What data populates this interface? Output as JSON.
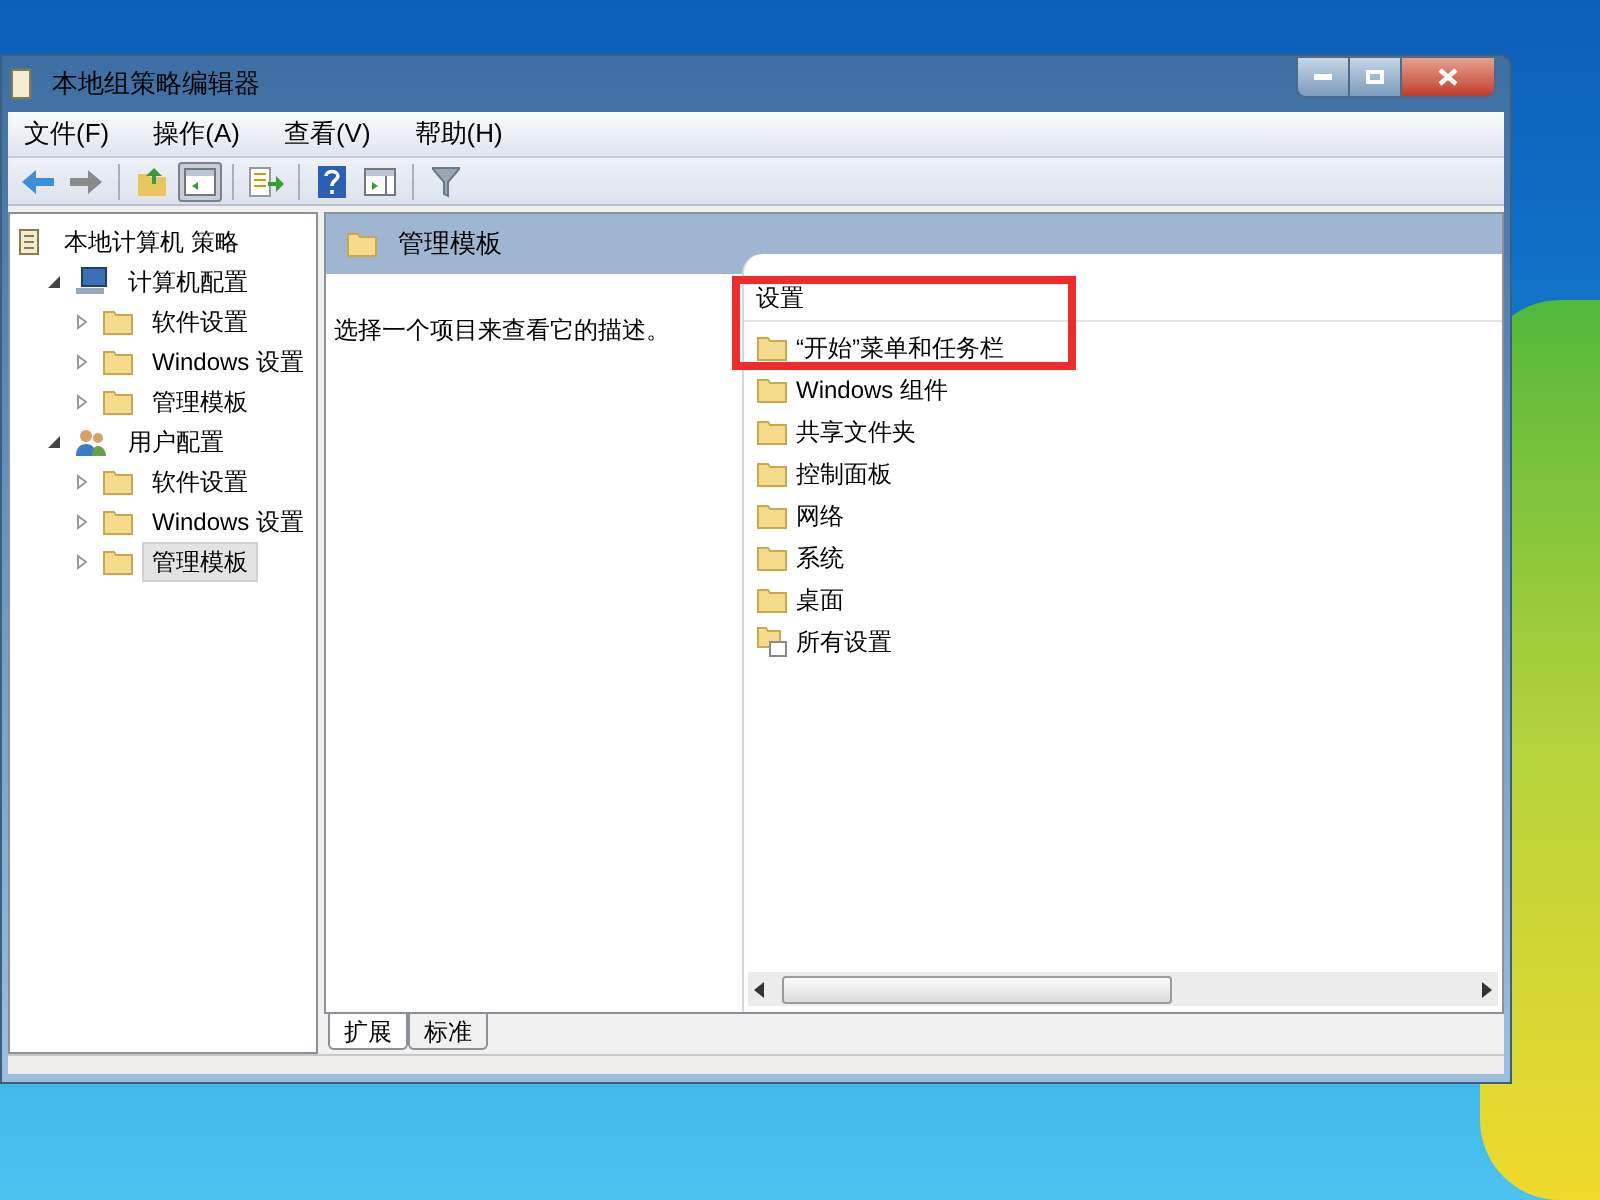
{
  "window": {
    "title": "本地组策略编辑器"
  },
  "menu": [
    "文件(F)",
    "操作(A)",
    "查看(V)",
    "帮助(H)"
  ],
  "toolbar": [
    {
      "kind": "back",
      "pressed": false
    },
    {
      "kind": "forward",
      "pressed": false
    },
    {
      "kind": "up",
      "pressed": false
    },
    {
      "kind": "tree",
      "pressed": true
    },
    {
      "kind": "export",
      "pressed": false
    },
    {
      "kind": "help",
      "pressed": false
    },
    {
      "kind": "pane",
      "pressed": false
    },
    {
      "kind": "filter",
      "pressed": false
    }
  ],
  "tree": [
    {
      "label": "本地计算机 策略",
      "kind": "policy",
      "selected": false,
      "children": [
        {
          "label": "计算机配置",
          "kind": "computer",
          "expanded": true,
          "selected": false,
          "children": [
            {
              "label": "软件设置",
              "kind": "folder",
              "expanded": false,
              "selected": false
            },
            {
              "label": "Windows 设置",
              "kind": "folder",
              "expanded": false,
              "selected": false
            },
            {
              "label": "管理模板",
              "kind": "folder",
              "expanded": false,
              "selected": false
            }
          ]
        },
        {
          "label": "用户配置",
          "kind": "user",
          "expanded": true,
          "selected": false,
          "children": [
            {
              "label": "软件设置",
              "kind": "folder",
              "expanded": false,
              "selected": false
            },
            {
              "label": "Windows 设置",
              "kind": "folder",
              "expanded": false,
              "selected": false
            },
            {
              "label": "管理模板",
              "kind": "folder",
              "expanded": false,
              "selected": true
            }
          ]
        }
      ]
    }
  ],
  "header": {
    "title": "管理模板"
  },
  "description": "选择一个项目来查看它的描述。",
  "list": {
    "column": "设置",
    "items": [
      {
        "label": "“开始”菜单和任务栏",
        "kind": "folder"
      },
      {
        "label": "Windows 组件",
        "kind": "folder"
      },
      {
        "label": "共享文件夹",
        "kind": "folder"
      },
      {
        "label": "控制面板",
        "kind": "folder"
      },
      {
        "label": "网络",
        "kind": "folder"
      },
      {
        "label": "系统",
        "kind": "folder"
      },
      {
        "label": "桌面",
        "kind": "folder"
      },
      {
        "label": "所有设置",
        "kind": "settings"
      }
    ]
  },
  "tabs": [
    {
      "label": "扩展",
      "selected": true
    },
    {
      "label": "标准",
      "selected": false
    }
  ]
}
